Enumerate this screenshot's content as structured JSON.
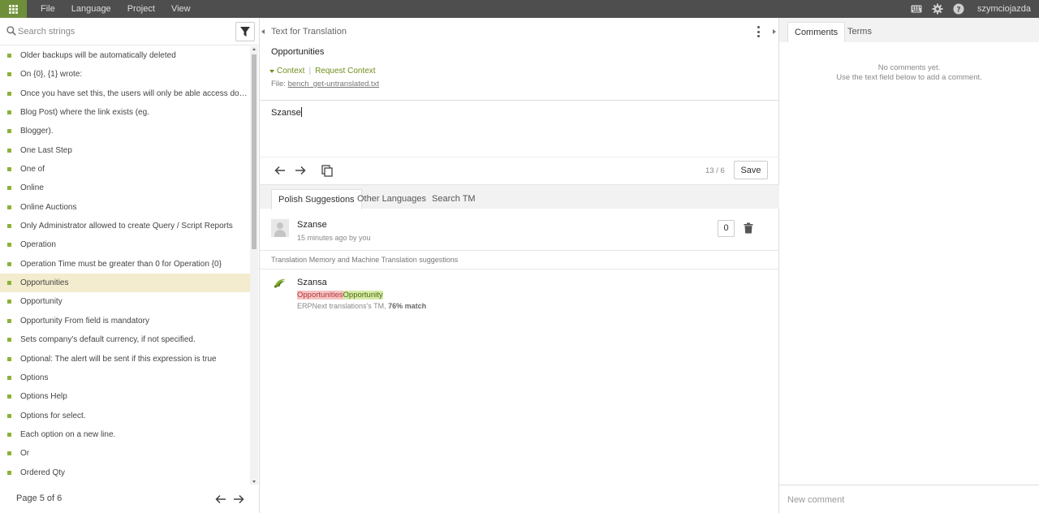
{
  "topbar": {
    "menu": [
      "File",
      "Language",
      "Project",
      "View"
    ],
    "username": "szymciojazda"
  },
  "search": {
    "placeholder": "Search strings"
  },
  "strings": [
    "Older backups will be automatically deleted",
    "On {0}, {1} wrote:",
    "Once you have set this, the users will only be able access documents (eg.",
    "Blog Post) where the link exists (eg.",
    "Blogger).",
    "One Last Step",
    "One of",
    "Online",
    "Online Auctions",
    "Only Administrator allowed to create Query / Script Reports",
    "Operation",
    "Operation Time must be greater than 0 for Operation {0}",
    "Opportunities",
    "Opportunity",
    "Opportunity From field is mandatory",
    "Sets company's default currency, if not specified.",
    "Optional: The alert will be sent if this expression is true",
    "Options",
    "Options Help",
    "Options for select.",
    "Each option on a new line.",
    "Or",
    "Ordered Qty"
  ],
  "selected_index": 12,
  "pager": {
    "label": "Page 5 of 6"
  },
  "editor": {
    "header": "Text for Translation",
    "source": "Opportunities",
    "context_label": "Context",
    "request_context_label": "Request Context",
    "file_prefix": "File:",
    "file_name": "bench_get-untranslated.txt",
    "translation": "Szanse",
    "counter": "13 / 6",
    "save_label": "Save"
  },
  "suggestion_tabs": [
    "Polish Suggestions",
    "Other Languages",
    "Search TM"
  ],
  "own_suggestion": {
    "text": "Szanse",
    "meta": "15 minutes ago by you",
    "votes": "0"
  },
  "tm": {
    "header": "Translation Memory and Machine Translation suggestions",
    "text": "Szansa",
    "diff_deleted": "Opportunities",
    "diff_inserted": "Opportunity",
    "source_prefix": "ERPNext translations's TM, ",
    "match": "76% match"
  },
  "comments": {
    "tabs": [
      "Comments",
      "Terms"
    ],
    "empty_line1": "No comments yet.",
    "empty_line2": "Use the text field below to add a comment.",
    "placeholder": "New comment"
  },
  "colors": {
    "accent": "#6f8e3a",
    "selected_row": "#f3ecce",
    "topbar": "#4e4e4e"
  }
}
